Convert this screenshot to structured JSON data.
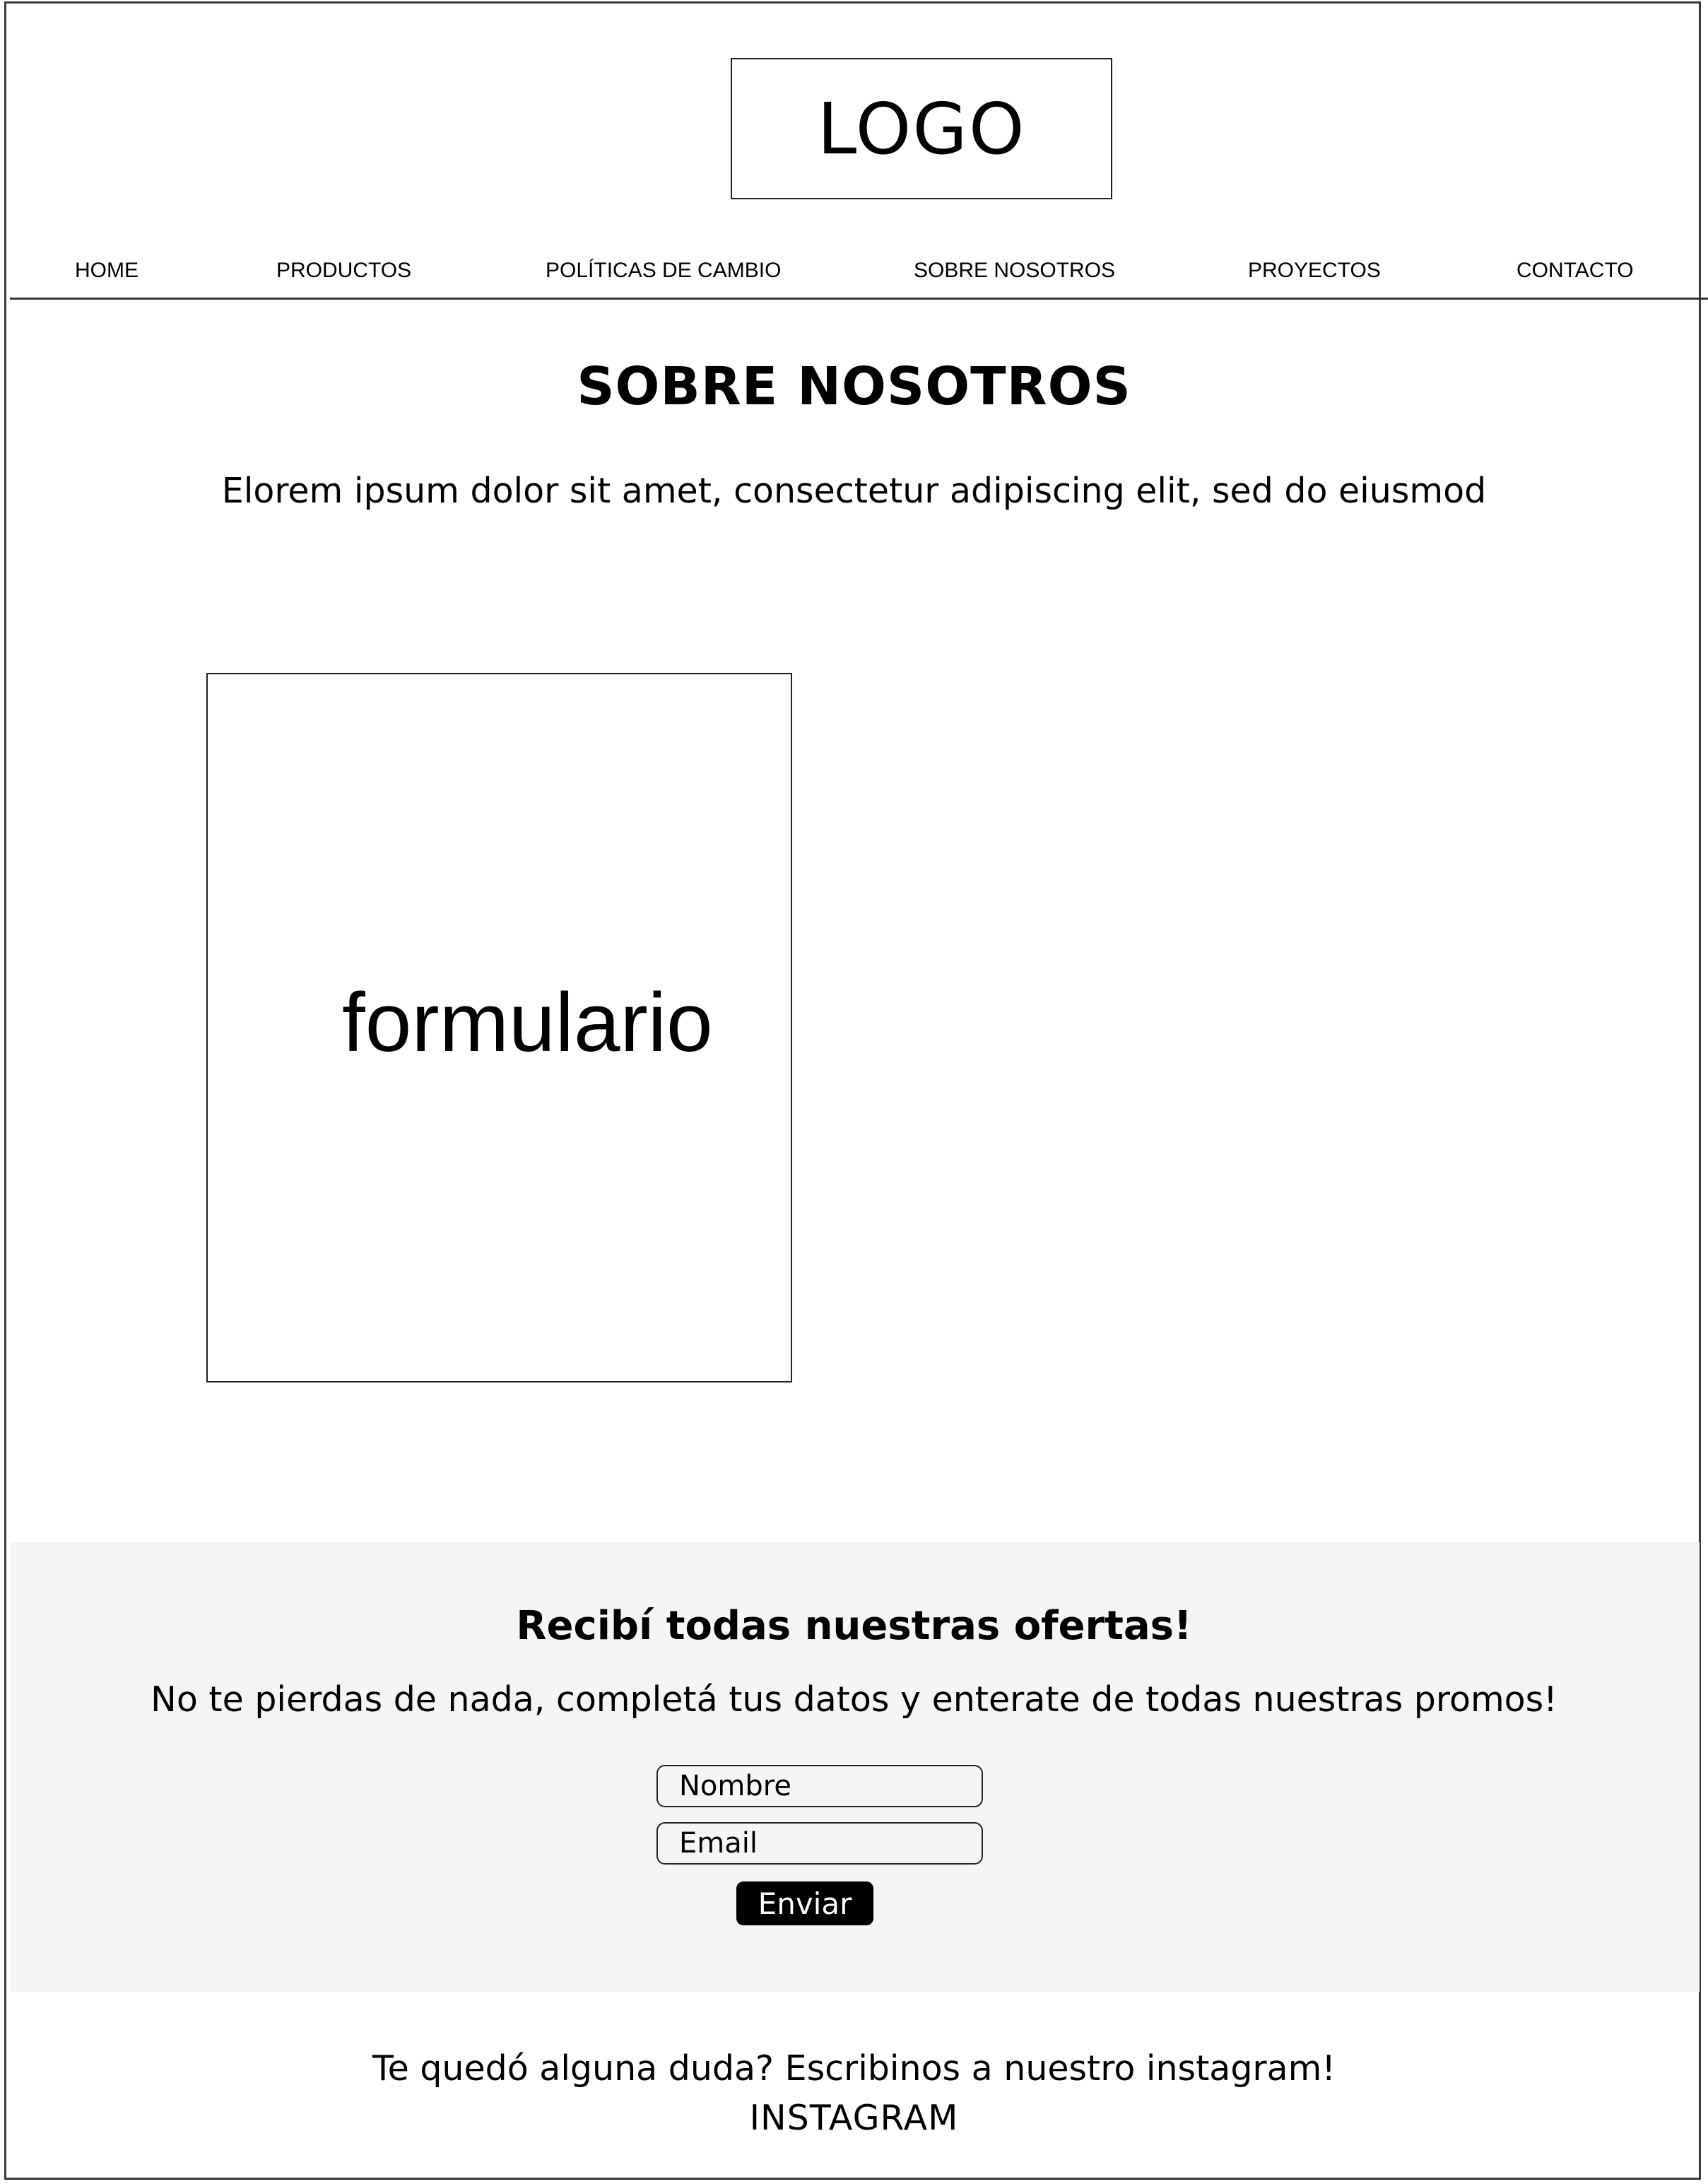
{
  "header": {
    "logo_text": "LOGO"
  },
  "nav": {
    "items": [
      {
        "label": "HOME"
      },
      {
        "label": "PRODUCTOS"
      },
      {
        "label": "POLÍTICAS DE CAMBIO"
      },
      {
        "label": "SOBRE NOSOTROS"
      },
      {
        "label": "PROYECTOS"
      },
      {
        "label": "CONTACTO"
      }
    ]
  },
  "main": {
    "title": "SOBRE NOSOTROS",
    "subtitle": "Elorem ipsum dolor sit amet, consectetur adipiscing elit, sed do eiusmod",
    "form_placeholder_label": "formulario"
  },
  "newsletter": {
    "title": "Recibí todas nuestras ofertas!",
    "text": "No te pierdas de nada, completá tus datos y enterate de todas nuestras promos!",
    "name_placeholder": "Nombre",
    "email_placeholder": "Email",
    "submit_label": "Enviar",
    "background_color": "#f5f5f5",
    "button_color": "#000000"
  },
  "footer": {
    "text": "Te quedó alguna duda? Escribinos a nuestro instagram!",
    "link_label": "INSTAGRAM"
  }
}
